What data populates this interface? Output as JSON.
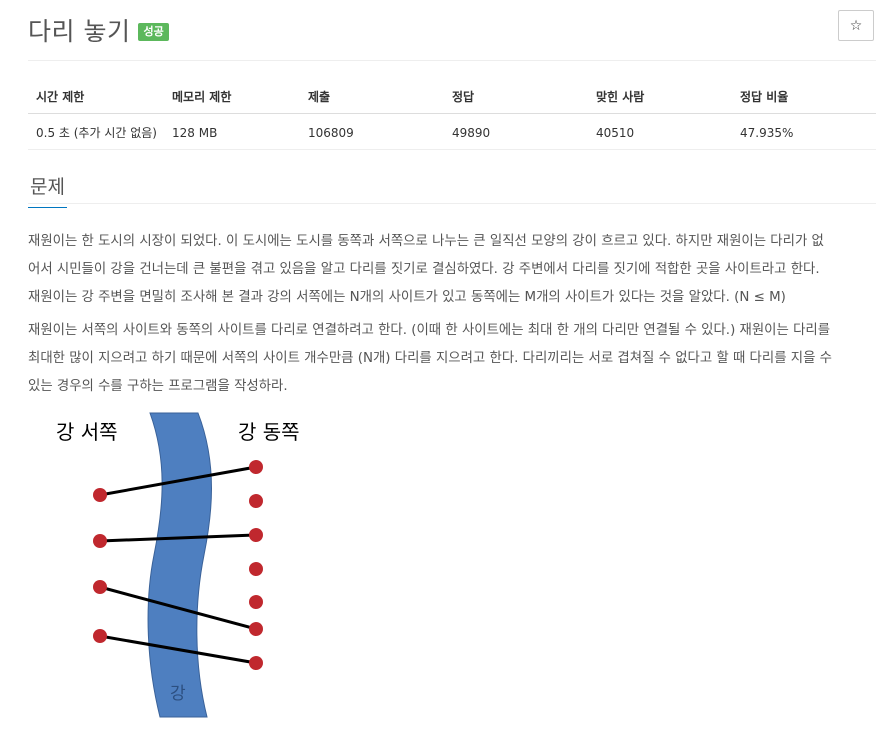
{
  "header": {
    "title": "다리 놓기",
    "status_badge": "성공",
    "star_icon": "☆"
  },
  "info_table": {
    "columns": [
      "시간 제한",
      "메모리 제한",
      "제출",
      "정답",
      "맞힌 사람",
      "정답 비율"
    ],
    "row": [
      "0.5 초 (추가 시간 없음)",
      "128 MB",
      "106809",
      "49890",
      "40510",
      "47.935%"
    ]
  },
  "problem": {
    "section_title": "문제",
    "paragraphs": [
      [
        "재원이는 한 도시의 시장이 되었다. 이 도시에는 도시를 동쪽과 서쪽으로 나누는 큰 일직선 모양의 강이 흐르고 있다. 하지만 재원이는 다리가 없",
        "어서 시민들이 강을 건너는데 큰 불편을 겪고 있음을 알고 다리를 짓기로 결심하였다. 강 주변에서 다리를 짓기에 적합한 곳을 사이트라고 한다.",
        "재원이는 강 주변을 면밀히 조사해 본 결과 강의 서쪽에는 N개의 사이트가 있고 동쪽에는 M개의 사이트가 있다는 것을 알았다. (N ≤ M)"
      ],
      [
        "재원이는 서쪽의 사이트와 동쪽의 사이트를 다리로 연결하려고 한다. (이때 한 사이트에는 최대 한 개의 다리만 연결될 수 있다.) 재원이는 다리를",
        "최대한 많이 지으려고 하기 때문에 서쪽의 사이트 개수만큼 (N개) 다리를 지으려고 한다. 다리끼리는 서로 겹쳐질 수 없다고 할 때 다리를 지을 수",
        "있는 경우의 수를 구하는 프로그램을 작성하라."
      ]
    ]
  },
  "figure": {
    "west_label": "강 서쪽",
    "east_label": "강 동쪽",
    "river_label": "강",
    "colors": {
      "river": "#4e7fc0",
      "river_edge": "#3a6299",
      "site": "#c0282e",
      "bridge": "#000000"
    }
  }
}
